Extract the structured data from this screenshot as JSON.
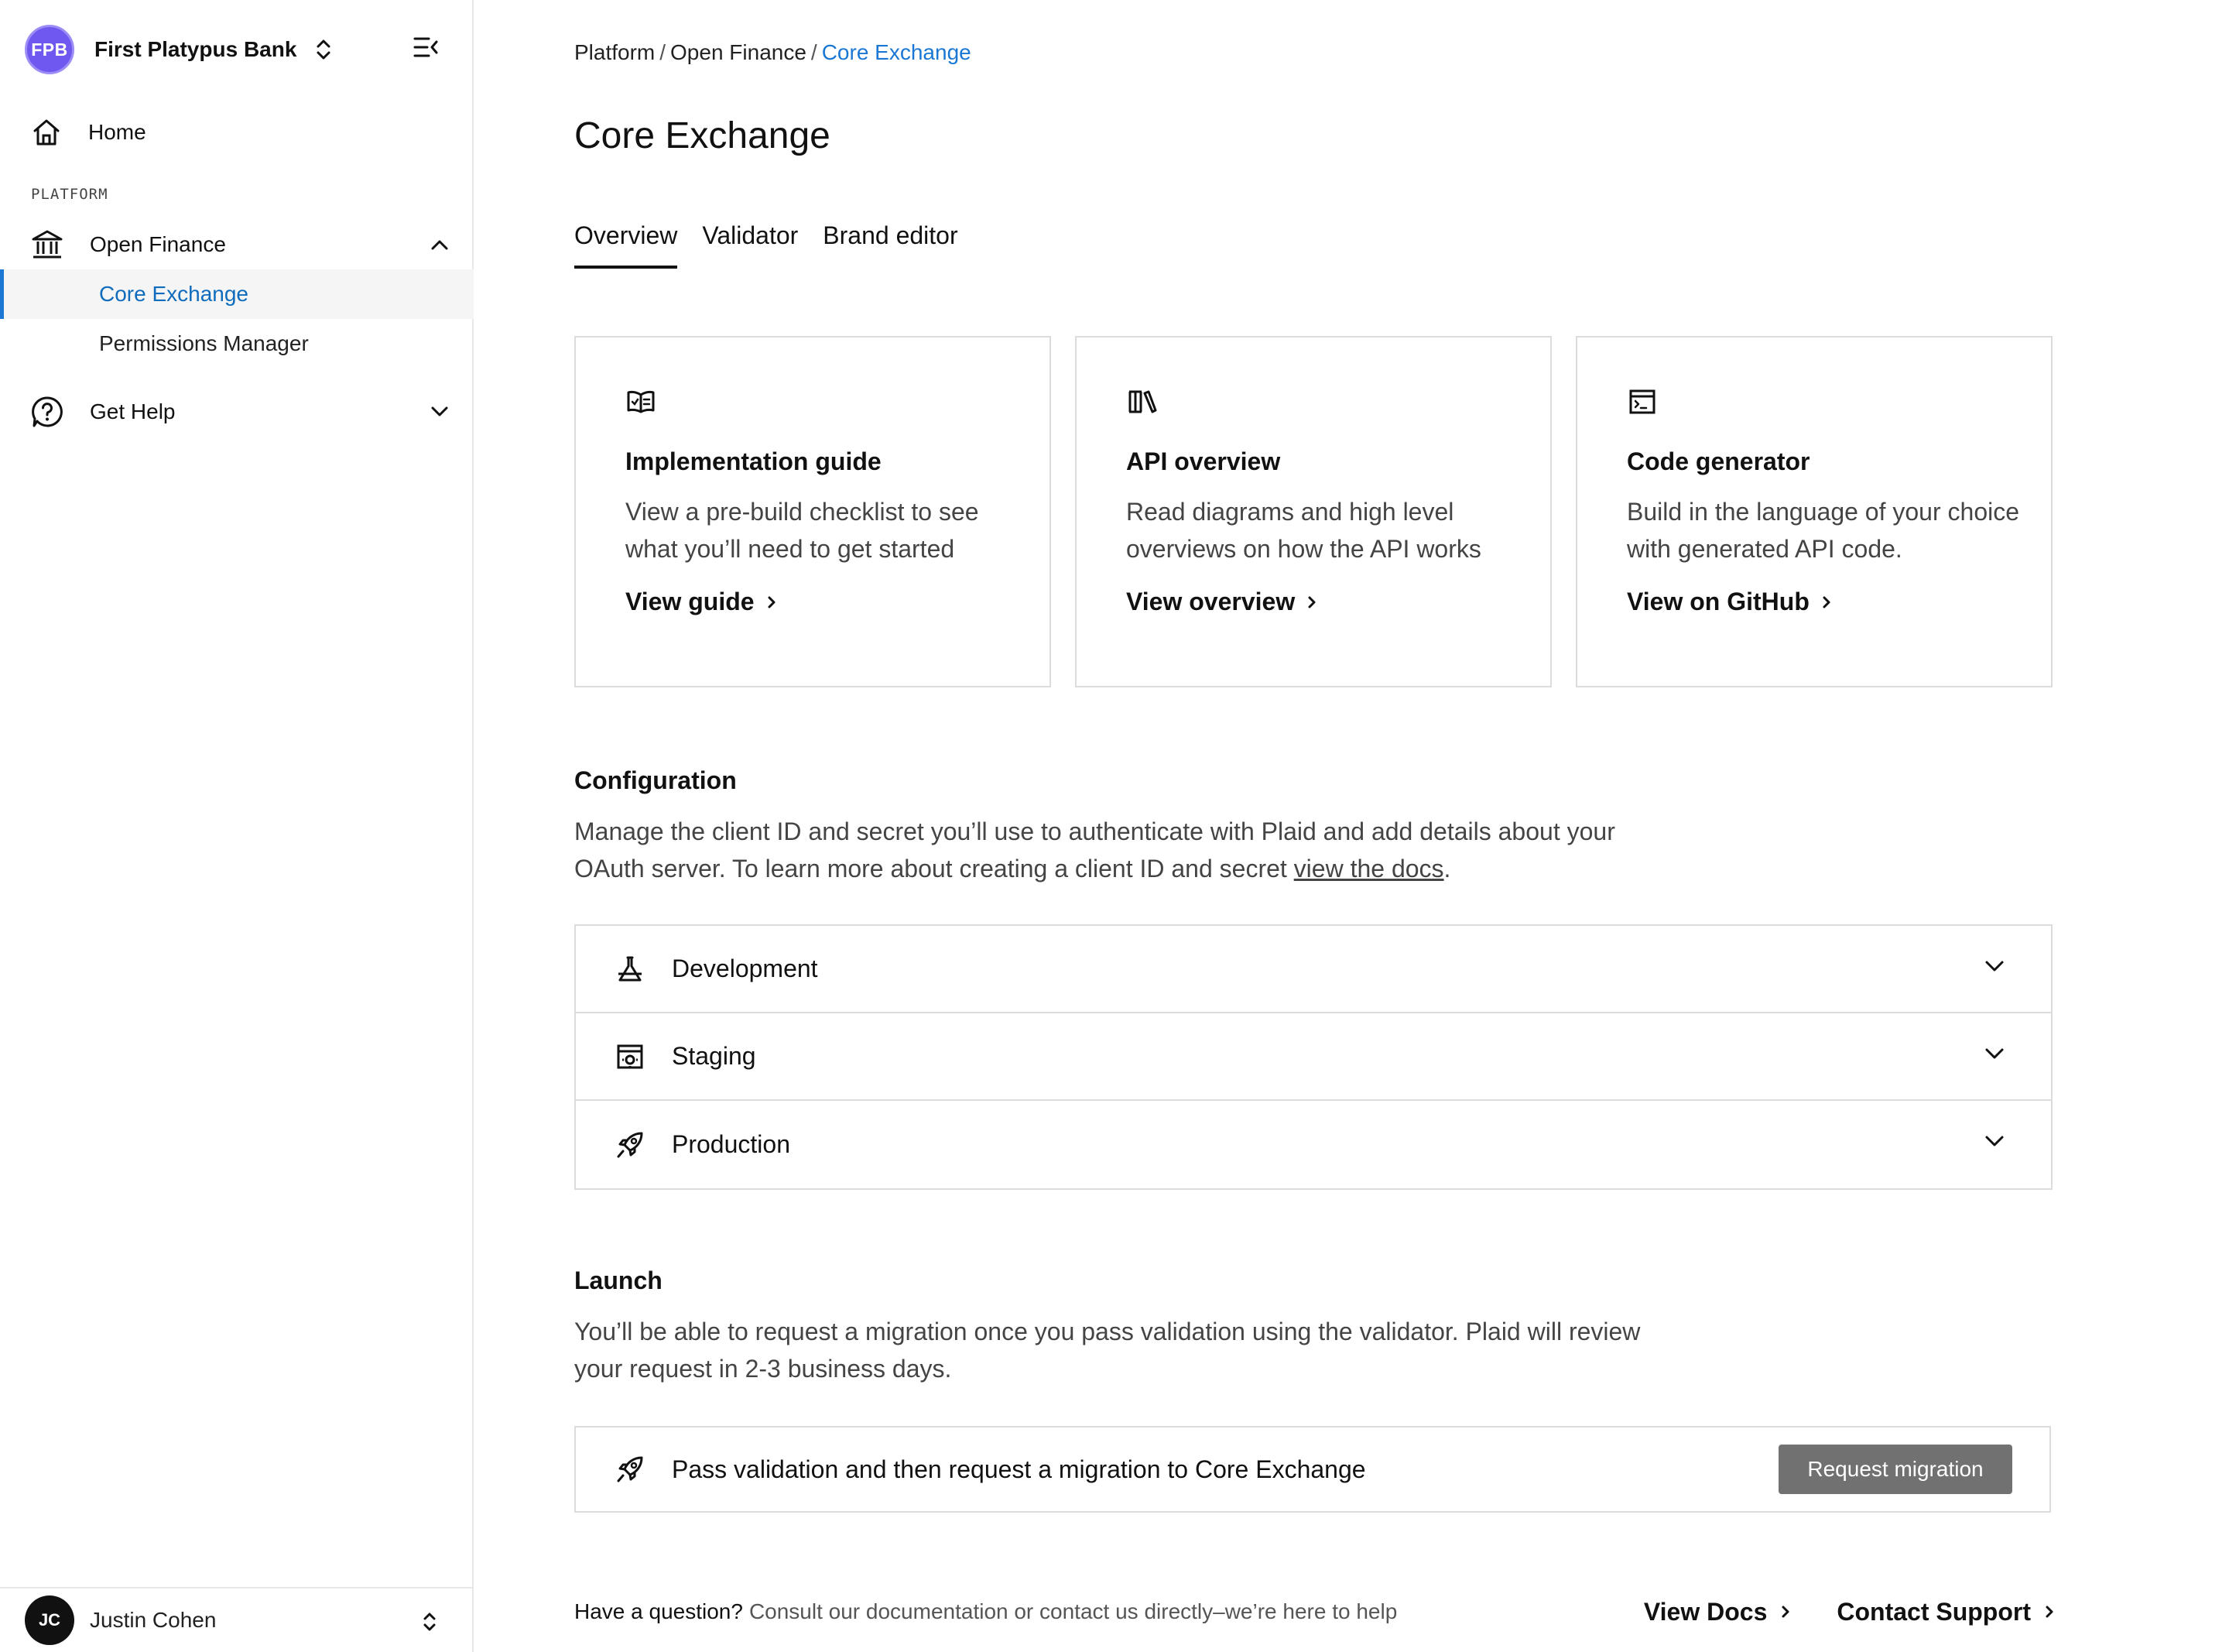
{
  "sidebar": {
    "org_initials": "FPB",
    "org_name": "First Platypus Bank",
    "home_label": "Home",
    "section_label": "PLATFORM",
    "open_finance_label": "Open Finance",
    "sub_items": [
      {
        "label": "Core Exchange",
        "active": true
      },
      {
        "label": "Permissions Manager",
        "active": false
      }
    ],
    "help_label": "Get Help",
    "user": {
      "initials": "JC",
      "name": "Justin Cohen"
    }
  },
  "breadcrumb": {
    "items": [
      "Platform",
      "Open Finance",
      "Core Exchange"
    ],
    "separator": "/"
  },
  "page_title": "Core Exchange",
  "tabs": [
    {
      "label": "Overview",
      "active": true
    },
    {
      "label": "Validator",
      "active": false
    },
    {
      "label": "Brand editor",
      "active": false
    }
  ],
  "cards": [
    {
      "icon": "book-open-icon",
      "title": "Implementation guide",
      "desc": "View a pre-build checklist to see what you’ll need to get started",
      "link": "View guide"
    },
    {
      "icon": "library-icon",
      "title": "API overview",
      "desc": "Read diagrams and high level overviews on how the API works",
      "link": "View overview"
    },
    {
      "icon": "terminal-window-icon",
      "title": "Code generator",
      "desc": "Build in the language of your choice with generated API code.",
      "link": "View on GitHub"
    }
  ],
  "configuration": {
    "heading": "Configuration",
    "body_prefix": "Manage the client ID and secret you’ll use to authenticate with Plaid and add details about your OAuth server. To learn more about creating a client ID and secret ",
    "body_link": "view the docs",
    "body_suffix": ".",
    "environments": [
      {
        "icon": "flask-icon",
        "label": "Development"
      },
      {
        "icon": "staging-icon",
        "label": "Staging"
      },
      {
        "icon": "rocket-icon",
        "label": "Production"
      }
    ]
  },
  "launch": {
    "heading": "Launch",
    "body": "You’ll be able to request a migration once you pass validation using the validator. Plaid will review your request in 2-3 business days.",
    "box_text": "Pass validation and then request a migration to Core Exchange",
    "button_label": "Request migration"
  },
  "footer": {
    "question": "Have a question?",
    "sub": "Consult our documentation or contact us directly–we’re here to help",
    "links": [
      "View Docs",
      "Contact Support"
    ]
  },
  "colors": {
    "accent": "#1a78d4",
    "org_logo": "#6e58f0",
    "button_disabled": "#717171",
    "border": "#dcdcdc"
  }
}
